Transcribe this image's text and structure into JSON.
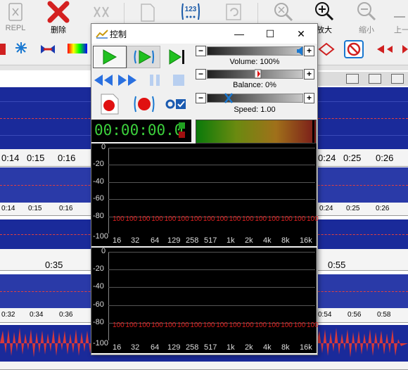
{
  "toolbar": {
    "repl_label": "REPL",
    "delete_label": "删除",
    "zoom_in_label": "放大",
    "zoom_out_label": "缩小",
    "up_label": "上一",
    "counter_label": "123"
  },
  "timeline": {
    "top_ruler": [
      "0:14",
      "0:15",
      "0:16",
      "0:24",
      "0:25",
      "0:26"
    ],
    "ruler2": [
      "0:14",
      "0:15",
      "0:16",
      "0:24",
      "0:25",
      "0:26"
    ],
    "ruler3": [
      "0:35",
      "0:55"
    ],
    "ruler4": [
      "0:32",
      "0:34",
      "0:36",
      "0:54",
      "0:56",
      "0:58"
    ]
  },
  "dialog": {
    "title": "控制",
    "minimize": "—",
    "maximize": "☐",
    "close": "✕",
    "volume_label": "Volume: 100%",
    "balance_label": "Balance: 0%",
    "speed_label": "Speed: 1.00",
    "minus": "−",
    "plus": "+",
    "time": "00:00:00.0",
    "volume_value": 1.0,
    "balance_value": 0.0,
    "speed_value": 1.0
  },
  "spectrum": {
    "y_labels": [
      "0",
      "-20",
      "-40",
      "-60",
      "-80",
      "-100"
    ],
    "freq_labels": [
      "16",
      "32",
      "64",
      "129",
      "258",
      "517",
      "1k",
      "2k",
      "4k",
      "8k",
      "16k"
    ],
    "band_values": [
      "100",
      "100",
      "100",
      "100",
      "100",
      "100",
      "100",
      "100",
      "100",
      "100",
      "100",
      "100",
      "100",
      "100",
      "100",
      "100"
    ]
  },
  "colors": {
    "wave_bg": "#1a2a9a",
    "time_green": "#3cd03c",
    "band_red": "#e02020"
  }
}
